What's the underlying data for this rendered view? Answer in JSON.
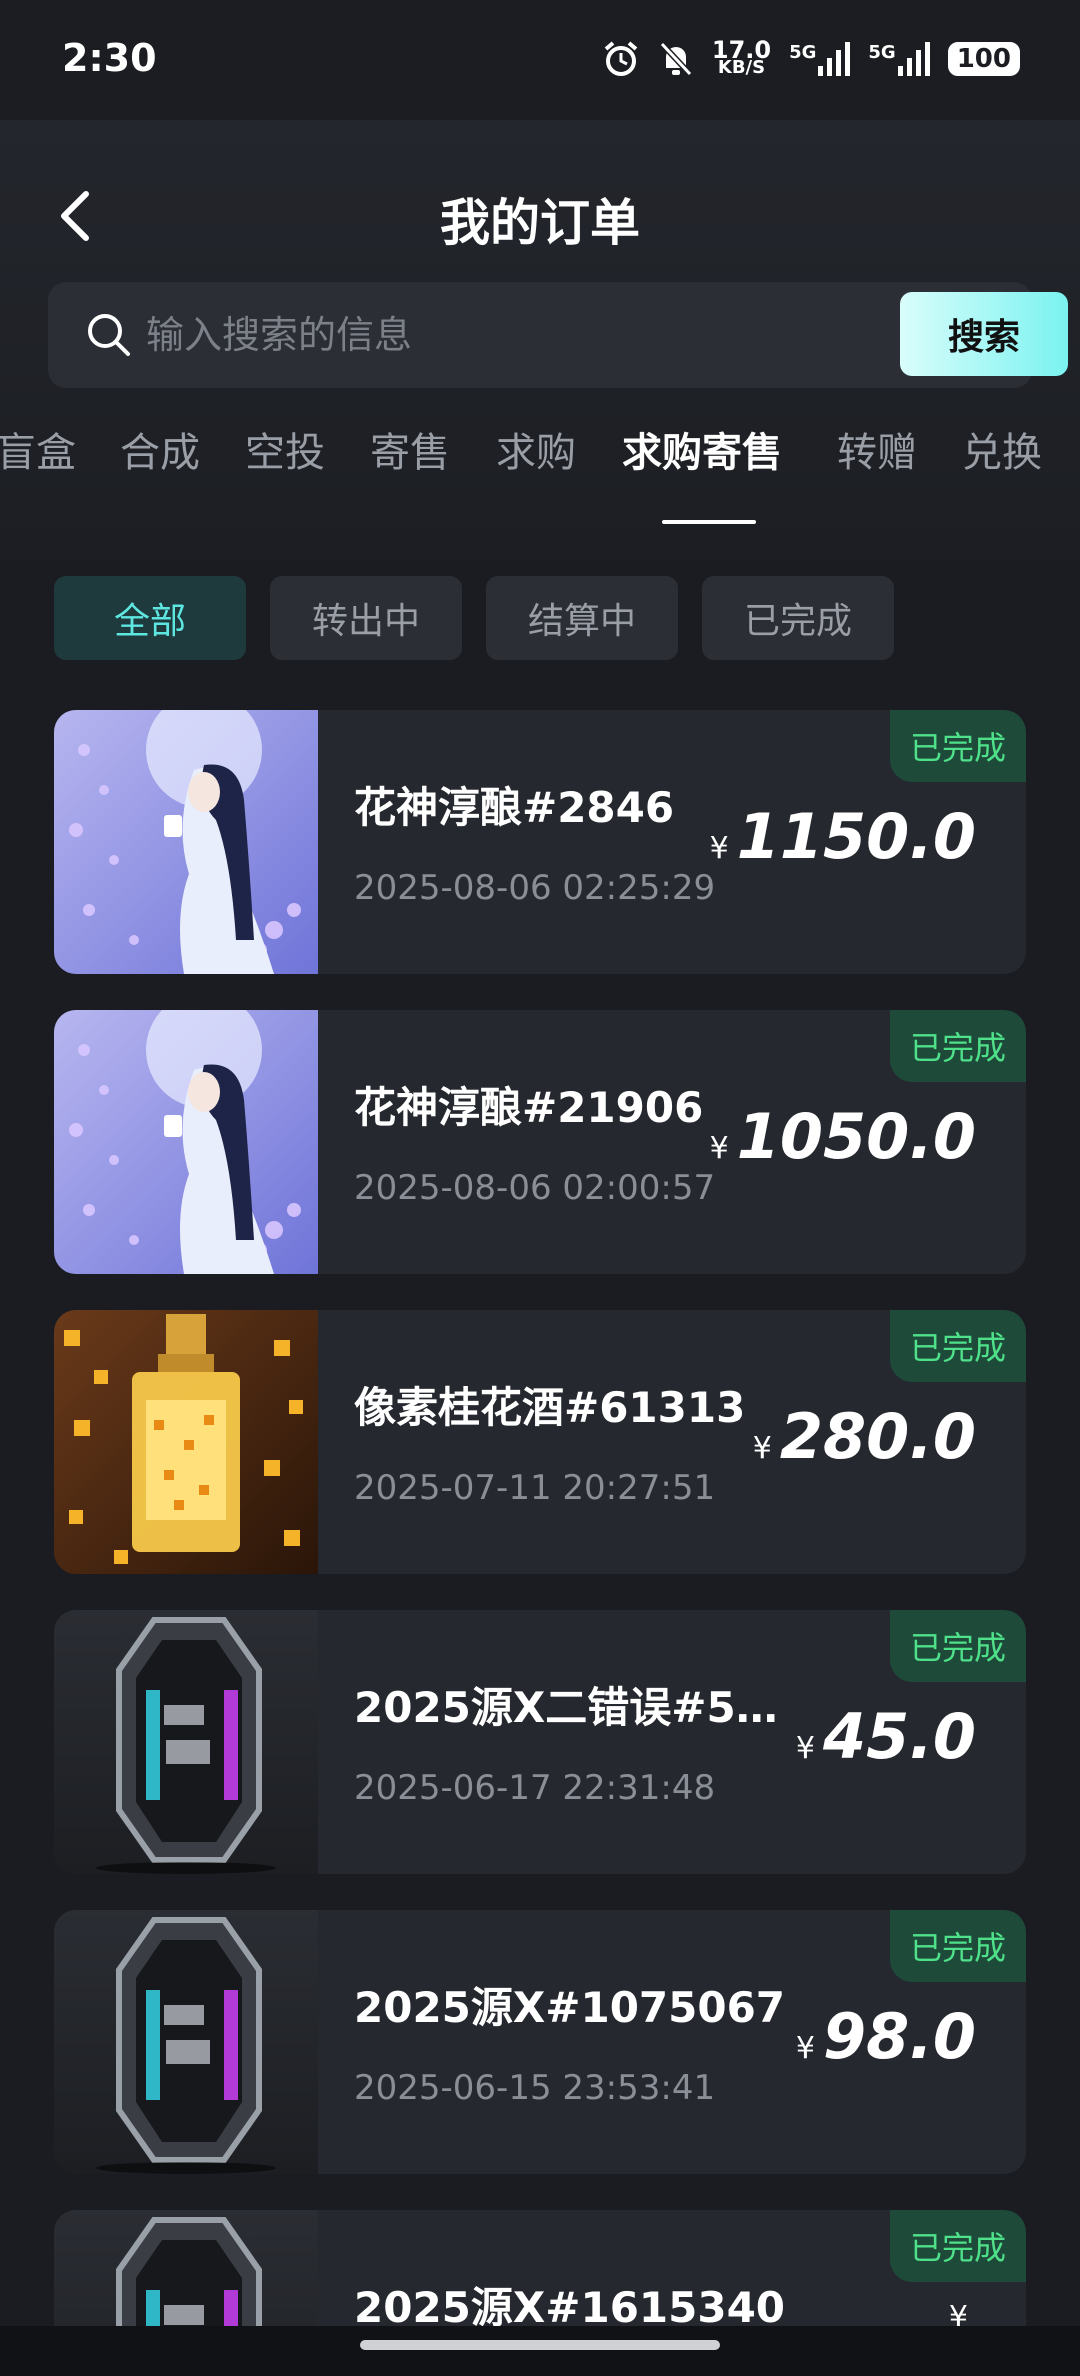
{
  "status_bar": {
    "time": "2:30",
    "net_speed": "17.0",
    "net_unit": "KB/S",
    "signal1": "5G",
    "signal2": "5G",
    "battery": "100"
  },
  "header": {
    "title": "我的订单"
  },
  "search": {
    "placeholder": "输入搜索的信息",
    "button_label": "搜索"
  },
  "tabs": [
    {
      "label": "盲盒"
    },
    {
      "label": "合成"
    },
    {
      "label": "空投"
    },
    {
      "label": "寄售"
    },
    {
      "label": "求购"
    },
    {
      "label": "求购寄售",
      "active": true
    },
    {
      "label": "转赠"
    },
    {
      "label": "兑换"
    }
  ],
  "filters": [
    {
      "label": "全部",
      "active": true
    },
    {
      "label": "转出中"
    },
    {
      "label": "结算中"
    },
    {
      "label": "已完成"
    }
  ],
  "currency_symbol": "¥",
  "orders": [
    {
      "name": "花神淳酿#2846",
      "date": "2025-08-06 02:25:29",
      "amount": "1150.0",
      "status": "已完成",
      "thumb": "lady"
    },
    {
      "name": "花神淳酿#21906",
      "date": "2025-08-06 02:00:57",
      "amount": "1050.0",
      "status": "已完成",
      "thumb": "lady"
    },
    {
      "name": "像素桂花酒#61313",
      "date": "2025-07-11 20:27:51",
      "amount": "280.0",
      "status": "已完成",
      "thumb": "bottle"
    },
    {
      "name": "2025源X二错误#54...",
      "date": "2025-06-17 22:31:48",
      "amount": "45.0",
      "status": "已完成",
      "thumb": "badge"
    },
    {
      "name": "2025源X#1075067",
      "date": "2025-06-15 23:53:41",
      "amount": "98.0",
      "status": "已完成",
      "thumb": "badge"
    },
    {
      "name": "2025源X#1615340",
      "date": "",
      "amount": "",
      "status": "已完成",
      "thumb": "badge"
    }
  ]
}
